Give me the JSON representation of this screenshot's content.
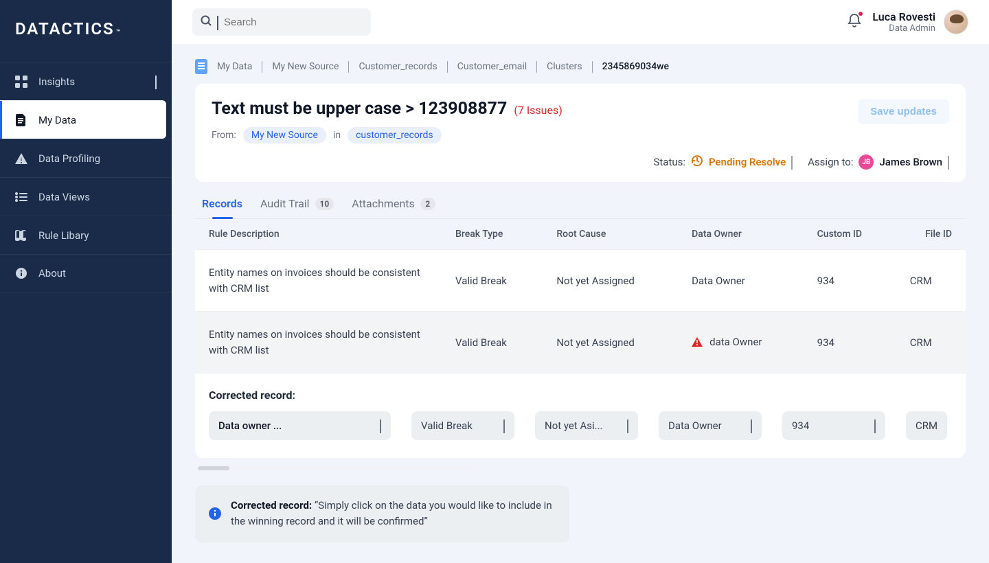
{
  "brand": "DATACTICS",
  "nav": [
    {
      "id": "insights",
      "label": "Insights",
      "expandable": true
    },
    {
      "id": "my-data",
      "label": "My Data",
      "active": true
    },
    {
      "id": "data-profiling",
      "label": "Data Profiling"
    },
    {
      "id": "data-views",
      "label": "Data Views"
    },
    {
      "id": "rule-library",
      "label": "Rule Libary"
    },
    {
      "id": "about",
      "label": "About"
    }
  ],
  "search": {
    "placeholder": "Search"
  },
  "user": {
    "name": "Luca Rovesti",
    "role": "Data Admin"
  },
  "breadcrumb": [
    "My Data",
    "My New Source",
    "Customer_records",
    "Customer_email",
    "Clusters",
    "2345869034we"
  ],
  "page": {
    "title": "Text must be upper case > 123908877",
    "issues_label": "(7 Issues)",
    "from_label": "From:",
    "from_source": "My New Source",
    "from_in": "in",
    "from_table": "customer_records",
    "save_label": "Save updates",
    "status_label": "Status:",
    "status_value": "Pending Resolve",
    "assign_label": "Assign to:",
    "assign_initials": "JB",
    "assign_value": "James Brown"
  },
  "tabs": [
    {
      "id": "records",
      "label": "Records",
      "active": true
    },
    {
      "id": "audit",
      "label": "Audit Trail",
      "count": "10"
    },
    {
      "id": "attachments",
      "label": "Attachments",
      "count": "2"
    }
  ],
  "columns": [
    "Rule Description",
    "Break Type",
    "Root Cause",
    "Data Owner",
    "Custom ID",
    "File ID"
  ],
  "rows": [
    {
      "desc": "Entity names on invoices should be consistent with CRM list",
      "break": "Valid Break",
      "root": "Not yet Assigned",
      "owner": "Data Owner",
      "ownerWarn": false,
      "custom": "934",
      "file": "CRM"
    },
    {
      "desc": "Entity names on invoices should be consistent with CRM list",
      "break": "Valid Break",
      "root": "Not yet Assigned",
      "owner": "data Owner",
      "ownerWarn": true,
      "custom": "934",
      "file": "CRM"
    }
  ],
  "corrected": {
    "title": "Corrected record:",
    "selects": [
      "Data owner ...",
      "Valid Break",
      "Not yet Asi...",
      "Data Owner",
      "934",
      "CRM"
    ]
  },
  "info": {
    "lead": "Corrected record:",
    "text": "“Simply click on the data you would like to include in the winning record and it will be confirmed”"
  }
}
